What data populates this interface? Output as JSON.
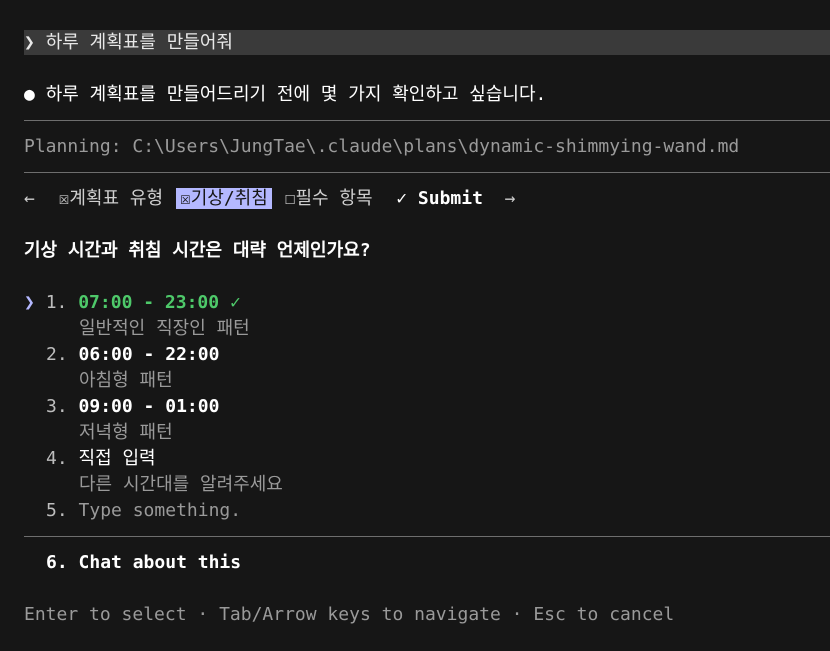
{
  "prompt": {
    "chevron": "❯",
    "text": "하루 계획표를 만들어줘"
  },
  "response": {
    "bullet": "●",
    "text": "하루 계획표를 만들어드리기 전에 몇 가지 확인하고 싶습니다."
  },
  "planning": {
    "text": "Planning: C:\\Users\\JungTae\\.claude\\plans\\dynamic-shimmying-wand.md"
  },
  "tabs": {
    "left_arrow": "←",
    "right_arrow": "→",
    "items": [
      {
        "checkbox": "☒",
        "label": "계획표 유형"
      },
      {
        "checkbox": "☒",
        "label": "기상/취침"
      },
      {
        "checkbox": "☐",
        "label": "필수 항목"
      }
    ],
    "submit_check": "✓",
    "submit_label": "Submit"
  },
  "question": "기상 시간과 취침 시간은 대략 언제인가요?",
  "options": [
    {
      "number": "1.",
      "label": "07:00 - 23:00",
      "check": "✓",
      "description": "일반적인 직장인 패턴"
    },
    {
      "number": "2.",
      "label": "06:00 - 22:00",
      "description": "아침형 패턴"
    },
    {
      "number": "3.",
      "label": "09:00 - 01:00",
      "description": "저녁형 패턴"
    },
    {
      "number": "4.",
      "label": "직접 입력",
      "description": "다른 시간대를 알려주세요"
    },
    {
      "number": "5.",
      "label": "Type something."
    }
  ],
  "selector": "❯",
  "chat_option": {
    "number": "6.",
    "label": "Chat about this"
  },
  "footer": "Enter to select · Tab/Arrow keys to navigate · Esc to cancel",
  "colors": {
    "background": "#161616",
    "accent": "#b4b8ff",
    "selected_green": "#4ec96a",
    "prompt_bar": "#3a3a3a"
  }
}
